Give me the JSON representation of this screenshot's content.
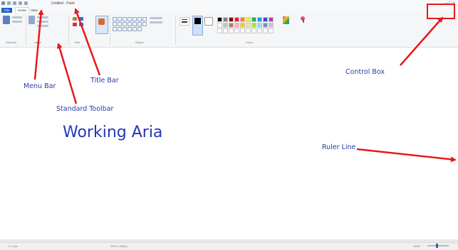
{
  "title_bar": {
    "title": "Untitled - Paint",
    "controls": "–  □  ×"
  },
  "menu_bar": {
    "file_label": "File",
    "tabs": [
      "Home",
      "View"
    ]
  },
  "ribbon": {
    "groups": [
      "Clipboard",
      "Image",
      "Tools",
      "Shapes",
      "Colors"
    ],
    "palette_colors": [
      "#000000",
      "#7f7f7f",
      "#880015",
      "#ed1c24",
      "#ff7f27",
      "#fff200",
      "#22b14c",
      "#00a2e8",
      "#3f48cc",
      "#a349a4",
      "#ffffff",
      "#c3c3c3",
      "#b97a57",
      "#ffaec9",
      "#ffc90e",
      "#efe4b0",
      "#b5e61d",
      "#99d9ea",
      "#7092be",
      "#c8bfe7"
    ]
  },
  "status_bar": {
    "left": "0 x 0px",
    "middle": "1152 x 648px",
    "zoom": "100%"
  },
  "annotations": {
    "menu_bar": "Menu Bar",
    "title_bar": "Title Bar",
    "standard_toolbar": "Standard Toolbar",
    "working_area": "Working Aria",
    "control_box": "Control Box",
    "ruler_line": "Ruler Line",
    "arrow_color": "#e8191c"
  }
}
